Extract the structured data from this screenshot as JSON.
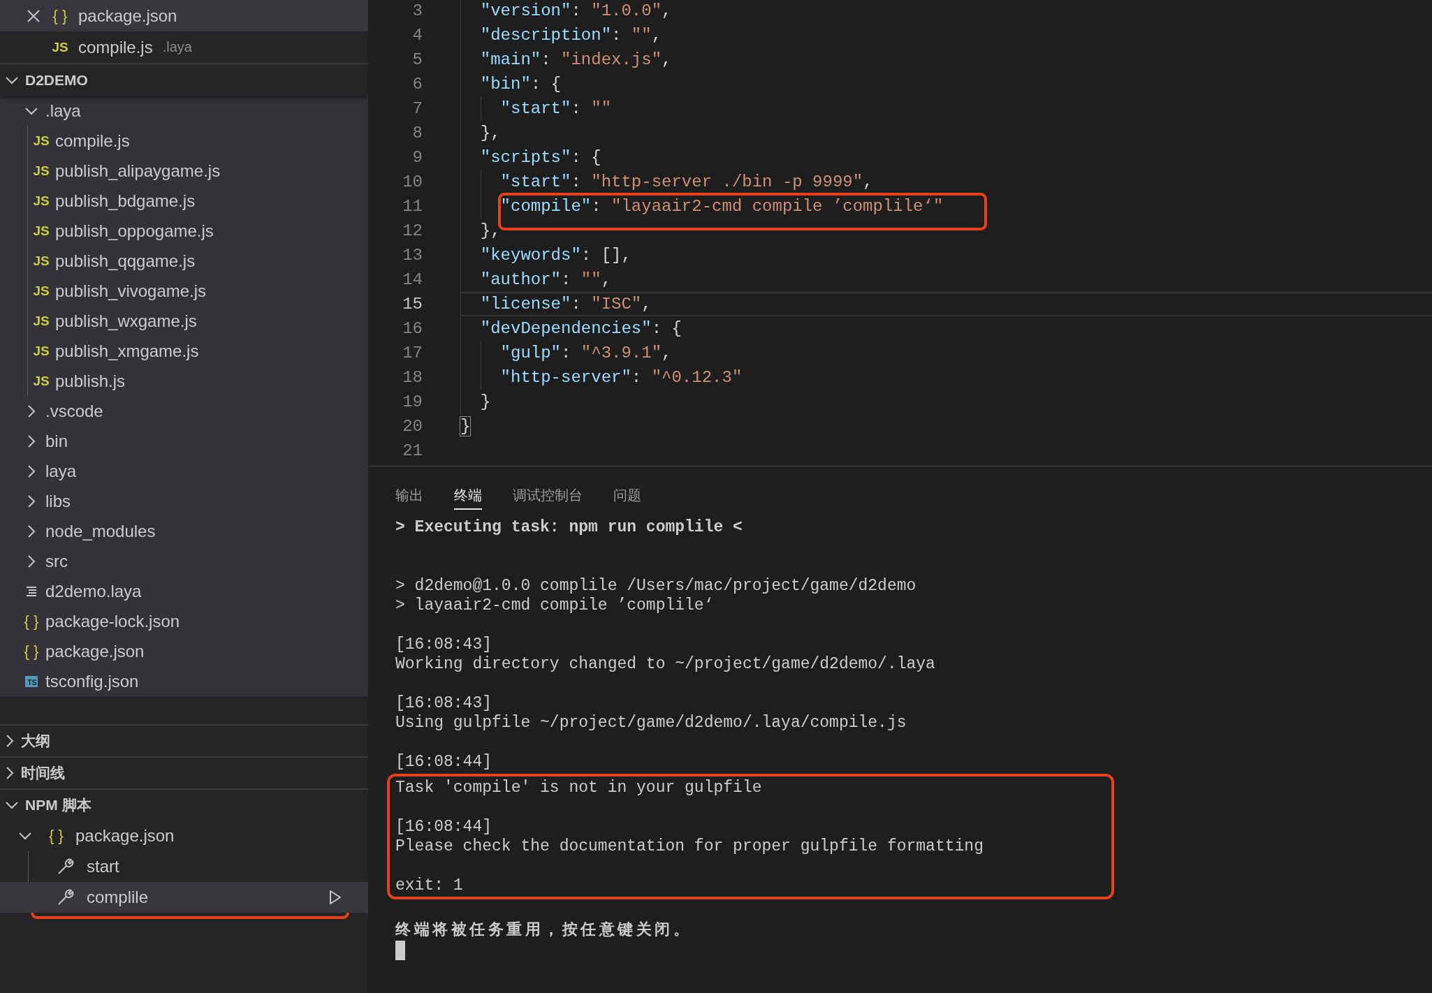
{
  "sidebar": {
    "open_editors": [
      {
        "kind": "json",
        "icon": "{ }",
        "name": "package.json",
        "selected": true
      },
      {
        "kind": "js",
        "icon": "JS",
        "name": "compile.js",
        "description": ".laya",
        "selected": false
      }
    ],
    "explorer": {
      "title": "D2DEMO",
      "expanded": true,
      "tree": [
        {
          "kind": "folder",
          "name": ".laya",
          "expanded": true,
          "children": [
            {
              "kind": "js",
              "icon": "JS",
              "name": "compile.js"
            },
            {
              "kind": "js",
              "icon": "JS",
              "name": "publish_alipaygame.js"
            },
            {
              "kind": "js",
              "icon": "JS",
              "name": "publish_bdgame.js"
            },
            {
              "kind": "js",
              "icon": "JS",
              "name": "publish_oppogame.js"
            },
            {
              "kind": "js",
              "icon": "JS",
              "name": "publish_qqgame.js"
            },
            {
              "kind": "js",
              "icon": "JS",
              "name": "publish_vivogame.js"
            },
            {
              "kind": "js",
              "icon": "JS",
              "name": "publish_wxgame.js"
            },
            {
              "kind": "js",
              "icon": "JS",
              "name": "publish_xmgame.js"
            },
            {
              "kind": "js",
              "icon": "JS",
              "name": "publish.js"
            }
          ]
        },
        {
          "kind": "folder",
          "name": ".vscode",
          "expanded": false
        },
        {
          "kind": "folder",
          "name": "bin",
          "expanded": false
        },
        {
          "kind": "folder",
          "name": "laya",
          "expanded": false
        },
        {
          "kind": "folder",
          "name": "libs",
          "expanded": false
        },
        {
          "kind": "folder",
          "name": "node_modules",
          "expanded": false
        },
        {
          "kind": "folder",
          "name": "src",
          "expanded": false
        },
        {
          "kind": "text",
          "name": "d2demo.laya"
        },
        {
          "kind": "json",
          "icon": "{ }",
          "name": "package-lock.json"
        },
        {
          "kind": "json",
          "icon": "{ }",
          "name": "package.json"
        },
        {
          "kind": "ts",
          "icon": "TS",
          "name": "tsconfig.json"
        }
      ]
    },
    "sections": [
      {
        "title": "大纲",
        "expanded": false
      },
      {
        "title": "时间线",
        "expanded": false
      },
      {
        "title": "NPM 脚本",
        "expanded": true,
        "files": [
          {
            "icon": "{ }",
            "name": "package.json",
            "expanded": true,
            "scripts": [
              {
                "name": "start",
                "selected": false,
                "annotated": false
              },
              {
                "name": "complile",
                "selected": true,
                "annotated": true
              }
            ]
          }
        ]
      }
    ]
  },
  "editor": {
    "lines": [
      {
        "number": "3",
        "current": false,
        "annotated": false,
        "tokens": [
          {
            "kind": "key",
            "text": "  \"version\""
          },
          {
            "kind": "punct",
            "text": ": "
          },
          {
            "kind": "string",
            "text": "\"1.0.0\""
          },
          {
            "kind": "punct",
            "text": ","
          }
        ]
      },
      {
        "number": "4",
        "current": false,
        "annotated": false,
        "tokens": [
          {
            "kind": "key",
            "text": "  \"description\""
          },
          {
            "kind": "punct",
            "text": ": "
          },
          {
            "kind": "string",
            "text": "\"\""
          },
          {
            "kind": "punct",
            "text": ","
          }
        ]
      },
      {
        "number": "5",
        "current": false,
        "annotated": false,
        "tokens": [
          {
            "kind": "key",
            "text": "  \"main\""
          },
          {
            "kind": "punct",
            "text": ": "
          },
          {
            "kind": "string",
            "text": "\"index.js\""
          },
          {
            "kind": "punct",
            "text": ","
          }
        ]
      },
      {
        "number": "6",
        "current": false,
        "annotated": false,
        "tokens": [
          {
            "kind": "key",
            "text": "  \"bin\""
          },
          {
            "kind": "punct",
            "text": ": {"
          }
        ]
      },
      {
        "number": "7",
        "current": false,
        "annotated": false,
        "tokens": [
          {
            "kind": "key",
            "text": "    \"start\""
          },
          {
            "kind": "punct",
            "text": ": "
          },
          {
            "kind": "string",
            "text": "\"\""
          }
        ]
      },
      {
        "number": "8",
        "current": false,
        "annotated": false,
        "tokens": [
          {
            "kind": "punct",
            "text": "  },"
          }
        ]
      },
      {
        "number": "9",
        "current": false,
        "annotated": false,
        "tokens": [
          {
            "kind": "key",
            "text": "  \"scripts\""
          },
          {
            "kind": "punct",
            "text": ": {"
          }
        ]
      },
      {
        "number": "10",
        "current": false,
        "annotated": false,
        "tokens": [
          {
            "kind": "key",
            "text": "    \"start\""
          },
          {
            "kind": "punct",
            "text": ": "
          },
          {
            "kind": "string",
            "text": "\"http-server ./bin -p 9999\""
          },
          {
            "kind": "punct",
            "text": ","
          }
        ]
      },
      {
        "number": "11",
        "current": false,
        "annotated": true,
        "tokens": [
          {
            "kind": "key",
            "text": "    \"compile\""
          },
          {
            "kind": "punct",
            "text": ": "
          },
          {
            "kind": "string",
            "text": "\"layaair2-cmd compile ’complile‘\""
          }
        ]
      },
      {
        "number": "12",
        "current": false,
        "annotated": false,
        "tokens": [
          {
            "kind": "punct",
            "text": "  },"
          }
        ]
      },
      {
        "number": "13",
        "current": false,
        "annotated": false,
        "tokens": [
          {
            "kind": "key",
            "text": "  \"keywords\""
          },
          {
            "kind": "punct",
            "text": ": [],"
          }
        ]
      },
      {
        "number": "14",
        "current": false,
        "annotated": false,
        "tokens": [
          {
            "kind": "key",
            "text": "  \"author\""
          },
          {
            "kind": "punct",
            "text": ": "
          },
          {
            "kind": "string",
            "text": "\"\""
          },
          {
            "kind": "punct",
            "text": ","
          }
        ]
      },
      {
        "number": "15",
        "current": true,
        "annotated": false,
        "tokens": [
          {
            "kind": "key",
            "text": "  \"license\""
          },
          {
            "kind": "punct",
            "text": ": "
          },
          {
            "kind": "string",
            "text": "\"ISC\""
          },
          {
            "kind": "punct",
            "text": ","
          }
        ]
      },
      {
        "number": "16",
        "current": false,
        "annotated": false,
        "tokens": [
          {
            "kind": "key",
            "text": "  \"devDependencies\""
          },
          {
            "kind": "punct",
            "text": ": {"
          }
        ]
      },
      {
        "number": "17",
        "current": false,
        "annotated": false,
        "tokens": [
          {
            "kind": "key",
            "text": "    \"gulp\""
          },
          {
            "kind": "punct",
            "text": ": "
          },
          {
            "kind": "string",
            "text": "\"^3.9.1\""
          },
          {
            "kind": "punct",
            "text": ","
          }
        ]
      },
      {
        "number": "18",
        "current": false,
        "annotated": false,
        "tokens": [
          {
            "kind": "key",
            "text": "    \"http-server\""
          },
          {
            "kind": "punct",
            "text": ": "
          },
          {
            "kind": "string",
            "text": "\"^0.12.3\""
          }
        ]
      },
      {
        "number": "19",
        "current": false,
        "annotated": false,
        "tokens": [
          {
            "kind": "punct",
            "text": "  }"
          }
        ]
      },
      {
        "number": "20",
        "current": false,
        "annotated": false,
        "tokens": [
          {
            "kind": "punct",
            "text": "}",
            "matched": true
          }
        ]
      },
      {
        "number": "21",
        "current": false,
        "annotated": false
      }
    ]
  },
  "panel": {
    "tabs": [
      {
        "label": "输出",
        "selected": false
      },
      {
        "label": "终端",
        "selected": true
      },
      {
        "label": "调试控制台",
        "selected": false
      },
      {
        "label": "问题",
        "selected": false
      }
    ],
    "terminal": {
      "cursor": true,
      "lines": [
        {
          "kind": "text",
          "text": "> Executing task: npm run complile <",
          "bold": true,
          "annotated": false
        },
        {
          "kind": "blank",
          "annotated": false
        },
        {
          "kind": "blank",
          "annotated": false
        },
        {
          "kind": "text",
          "text": "> d2demo@1.0.0 complile /Users/mac/project/game/d2demo",
          "bold": false,
          "annotated": false
        },
        {
          "kind": "text",
          "text": "> layaair2-cmd compile ’complile‘",
          "bold": false,
          "annotated": false
        },
        {
          "kind": "blank",
          "annotated": false
        },
        {
          "kind": "text",
          "text": "[16:08:43]",
          "bold": false,
          "annotated": false
        },
        {
          "kind": "text",
          "text": "Working directory changed to ~/project/game/d2demo/.laya",
          "bold": false,
          "annotated": false
        },
        {
          "kind": "blank",
          "annotated": false
        },
        {
          "kind": "text",
          "text": "[16:08:43]",
          "bold": false,
          "annotated": false
        },
        {
          "kind": "text",
          "text": "Using gulpfile ~/project/game/d2demo/.laya/compile.js",
          "bold": false,
          "annotated": false
        },
        {
          "kind": "blank",
          "annotated": false
        },
        {
          "kind": "text",
          "text": "[16:08:44]",
          "bold": false,
          "annotated": false
        },
        {
          "kind": "text",
          "text": "Task 'compile' is not in your gulpfile",
          "bold": false,
          "annotated": true
        },
        {
          "kind": "blank",
          "annotated": true
        },
        {
          "kind": "text",
          "text": "[16:08:44]",
          "bold": false,
          "annotated": true
        },
        {
          "kind": "text",
          "text": "Please check the documentation for proper gulpfile formatting",
          "bold": false,
          "annotated": true
        },
        {
          "kind": "blank",
          "annotated": true
        },
        {
          "kind": "text",
          "text": "exit: 1",
          "bold": false,
          "annotated": true
        },
        {
          "kind": "blank",
          "annotated": false
        },
        {
          "kind": "text",
          "text": "终端将被任务重用，按任意键关闭。",
          "bold": true,
          "annotated": false
        }
      ]
    }
  }
}
